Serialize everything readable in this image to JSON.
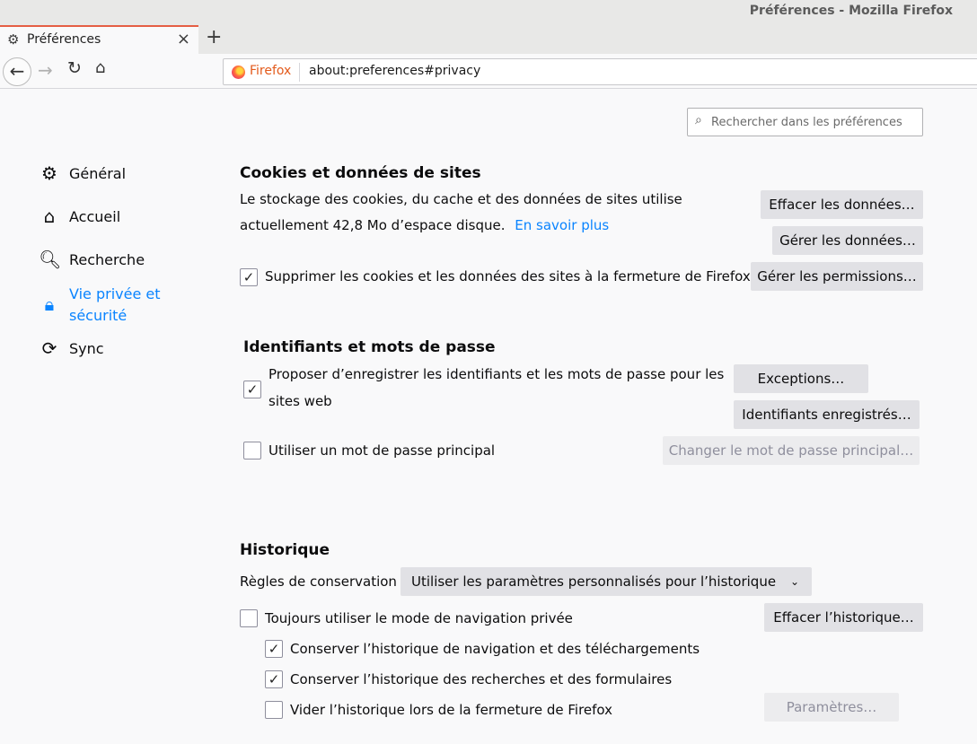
{
  "window": {
    "title": "Préférences - Mozilla Firefox"
  },
  "tab": {
    "label": "Préférences",
    "close": "×",
    "new_tab": "+"
  },
  "nav": {
    "back": "←",
    "forward": "→",
    "reload": "↻",
    "home": "⌂"
  },
  "urlbar": {
    "brand": "Firefox",
    "url": "about:preferences#privacy"
  },
  "search": {
    "placeholder": "Rechercher dans les préférences",
    "value": ""
  },
  "sidebar": {
    "items": [
      {
        "label": "Général",
        "icon": "gear-icon",
        "glyph": "⚙"
      },
      {
        "label": "Accueil",
        "icon": "home-icon",
        "glyph": "⌂"
      },
      {
        "label": "Recherche",
        "icon": "search-icon",
        "glyph": "🔍︎"
      },
      {
        "label": "Vie privée et sécurité",
        "icon": "lock-icon",
        "glyph": "🔒︎",
        "active": true
      },
      {
        "label": "Sync",
        "icon": "sync-icon",
        "glyph": "⟳"
      }
    ]
  },
  "cookies": {
    "title": "Cookies et données de sites",
    "desc_line1": "Le stockage des cookies, du cache et des données de sites utilise",
    "desc_line2": "actuellement 42,8 Mo d’espace disque.",
    "learn_more": "En savoir plus",
    "clear_button": "Effacer les données…",
    "manage_button": "Gérer les données…",
    "delete_on_close_label": "Supprimer les cookies et les données des sites à la fermeture de Firefox",
    "delete_on_close_checked": true,
    "permissions_button": "Gérer les permissions…"
  },
  "logins": {
    "title": "Identifiants et mots de passe",
    "offer_save_line1": "Proposer d’enregistrer les identifiants et les mots de passe pour les",
    "offer_save_line2": "sites web",
    "offer_save_checked": true,
    "exceptions_button": "Exceptions…",
    "saved_logins_button": "Identifiants enregistrés…",
    "primary_password_label": "Utiliser un mot de passe principal",
    "primary_password_checked": false,
    "change_primary_button": "Changer le mot de passe principal…"
  },
  "history": {
    "title": "Historique",
    "rules_label": "Règles de conservation",
    "rules_value": "Utiliser les paramètres personnalisés pour l’historique",
    "clear_button": "Effacer l’historique…",
    "always_private_label": "Toujours utiliser le mode de navigation privée",
    "always_private_checked": false,
    "keep_browsing_label": "Conserver l’historique de navigation et des téléchargements",
    "keep_browsing_checked": true,
    "keep_search_label": "Conserver l’historique des recherches et des formulaires",
    "keep_search_checked": true,
    "clear_on_close_label": "Vider l’historique lors de la fermeture de Firefox",
    "clear_on_close_checked": false,
    "settings_button": "Paramètres…"
  },
  "colors": {
    "accent": "#0a84ff",
    "tab_highlight": "#e55e44",
    "button_bg": "#e1e1e5"
  }
}
